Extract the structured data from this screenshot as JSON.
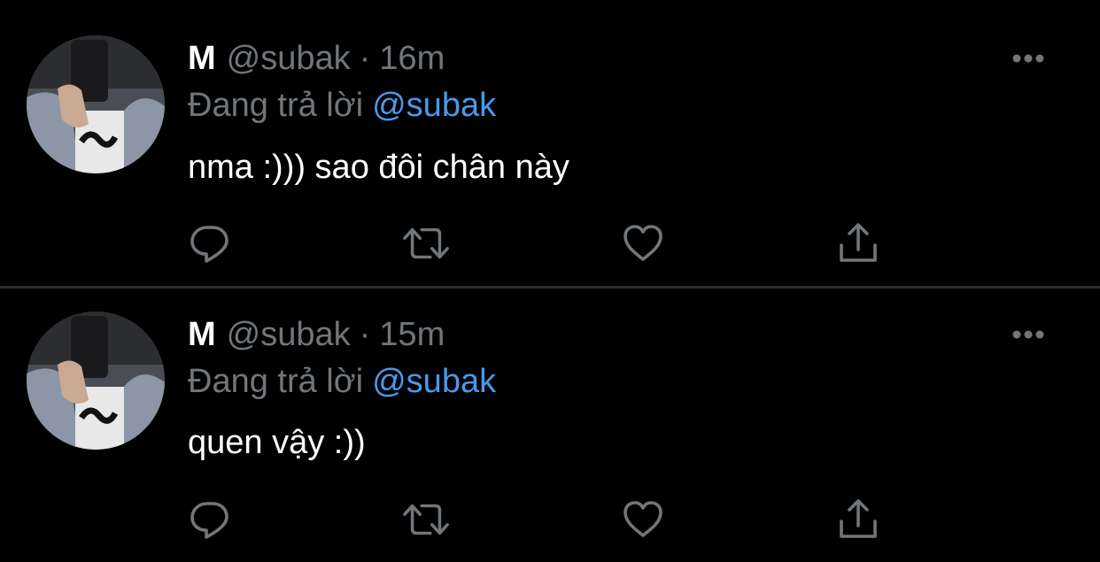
{
  "tweets": [
    {
      "author": {
        "name": "M",
        "handle": "@subak"
      },
      "separator": "·",
      "time": "16m",
      "reply_prefix": "Đang trả lời",
      "reply_mention": "@subak",
      "text": "nma :))) sao đôi chân này",
      "actions": [
        "reply-icon",
        "retweet-icon",
        "like-icon",
        "share-icon"
      ]
    },
    {
      "author": {
        "name": "M",
        "handle": "@subak"
      },
      "separator": "·",
      "time": "15m",
      "reply_prefix": "Đang trả lời",
      "reply_mention": "@subak",
      "text": "quen vậy :))",
      "actions": [
        "reply-icon",
        "retweet-icon",
        "like-icon",
        "share-icon"
      ]
    }
  ],
  "colors": {
    "background": "#000000",
    "primary_text": "#ffffff",
    "secondary_text": "#71767b",
    "mention": "#4a99e9",
    "icon": "#71767b",
    "divider": "#2a2c2e"
  }
}
